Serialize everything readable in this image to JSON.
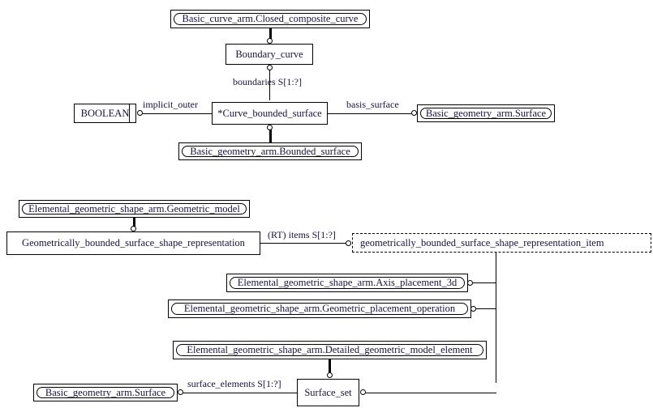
{
  "diagram": {
    "title": "EXPRESS-G diagram: Geometrically_bounded_surface_shape_representation",
    "background_color": "#ffffff",
    "line_color": "#000000",
    "text_color": "#15153a"
  },
  "entities": {
    "closed_composite_curve": "Basic_curve_arm.Closed_composite_curve",
    "boundary_curve": "Boundary_curve",
    "boolean": "BOOLEAN",
    "curve_bounded_surface": "*Curve_bounded_surface",
    "bounded_surface": "Basic_geometry_arm.Bounded_surface",
    "surface_top_right": "Basic_geometry_arm.Surface",
    "geometric_model": "Elemental_geometric_shape_arm.Geometric_model",
    "gbssr": "Geometrically_bounded_surface_shape_representation",
    "gbssr_item": "geometrically_bounded_surface_shape_representation_item",
    "axis_placement_3d": "Elemental_geometric_shape_arm.Axis_placement_3d",
    "geometric_placement_operation": "Elemental_geometric_shape_arm.Geometric_placement_operation",
    "detailed_geometric_model_element": "Elemental_geometric_shape_arm.Detailed_geometric_model_element",
    "surface_bottom_left": "Basic_geometry_arm.Surface",
    "surface_set": "Surface_set"
  },
  "edge_labels": {
    "boundaries": "boundaries S[1:?]",
    "implicit_outer": "implicit_outer",
    "basis_surface": "basis_surface",
    "rt_items": "(RT) items S[1:?]",
    "surface_elements": "surface_elements S[1:?]"
  }
}
